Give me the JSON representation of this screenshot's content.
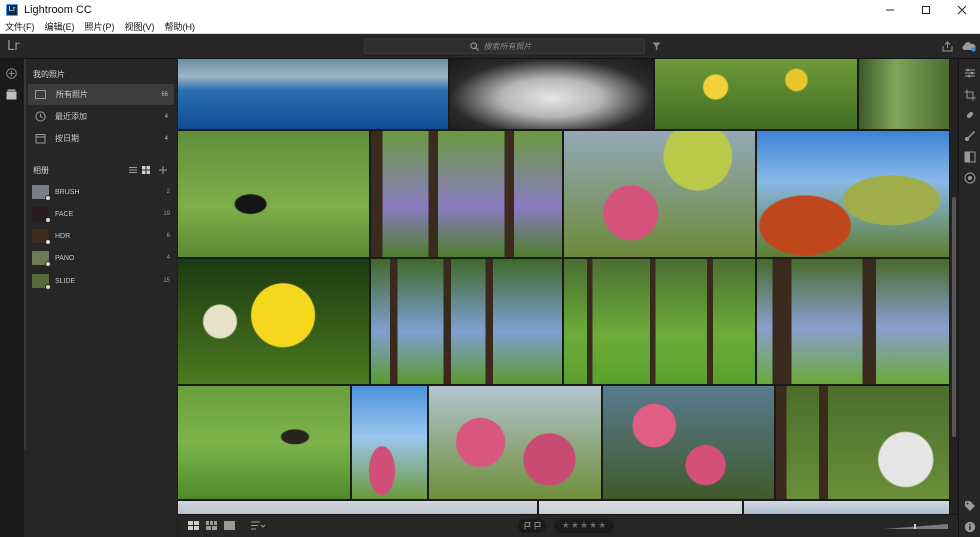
{
  "window": {
    "title": "Lightroom CC",
    "app_badge": "Lr"
  },
  "menu": [
    "文件(F)",
    "编辑(E)",
    "照片(P)",
    "视图(V)",
    "帮助(H)"
  ],
  "appbar": {
    "logo": "Lr",
    "search_placeholder": "搜索所有照片"
  },
  "left_panel": {
    "my_photos_title": "我的照片",
    "nav": [
      {
        "label": "所有照片",
        "count": "66",
        "icon": "photo-stack-icon",
        "active": true
      },
      {
        "label": "最近添加",
        "count": "4",
        "icon": "clock-icon",
        "active": false
      },
      {
        "label": "按日期",
        "count": "4",
        "icon": "calendar-icon",
        "active": false
      }
    ],
    "albums_title": "相册",
    "albums": [
      {
        "label": "BRUSH",
        "count": "2",
        "thumb": "#7a7f83"
      },
      {
        "label": "FACE",
        "count": "19",
        "thumb": "#2b1a1f"
      },
      {
        "label": "HDR",
        "count": "6",
        "thumb": "#3d2c1d"
      },
      {
        "label": "PANO",
        "count": "4",
        "thumb": "#6e7a55"
      },
      {
        "label": "SLIDE",
        "count": "15",
        "thumb": "#556b3a"
      }
    ]
  },
  "photos": [
    {
      "name": "pool",
      "bg": "linear-gradient(#6b8fa6 0%, #9fb6c4 25%, #2b6fb1 45%, #0f4c93 100%)"
    },
    {
      "name": "supercar",
      "bg": "radial-gradient(ellipse at 50% 55%, #e6e6e6 0%, #b5b5b5 35%, #2a2a2a 70%, #1a1a1a 100%)"
    },
    {
      "name": "yellow-flowers",
      "bg": "radial-gradient(circle at 30% 40%, #f2d13a 0 8%, transparent 9%), radial-gradient(circle at 70% 30%, #e9c52c 0 7%, transparent 8%), linear-gradient(#6e9a3a, #3f6e22)"
    },
    {
      "name": "forest-path-top",
      "bg": "linear-gradient(90deg, #3d5a2a, #7fa55a 40%, #4b6d31)"
    },
    {
      "name": "blackbird",
      "bg": "radial-gradient(ellipse at 38% 58%, #151515 0 9%, transparent 10%), linear-gradient(#5f8f3b, #7fae4a 60%, #5a8a32)"
    },
    {
      "name": "violet-forest",
      "bg": "linear-gradient(90deg, #3b2a1e 0 6%, transparent 6% 30%, #3b2a1e 30% 35%, transparent 35% 70%, #3b2a1e 70% 75%, transparent 75%), linear-gradient(#6a9a3e, #8a7ac0 60%, #4f7f2d)"
    },
    {
      "name": "pink-blossom-tree",
      "bg": "radial-gradient(circle at 35% 65%, #d5527c 0 18%, transparent 19%), radial-gradient(circle at 70% 20%, #b9c94a 0 20%, transparent 21%), linear-gradient(#94a8b8, #6c8a3a)"
    },
    {
      "name": "autumn-sky",
      "bg": "radial-gradient(ellipse at 25% 75%, #c0461c 0 22%, transparent 23%), radial-gradient(ellipse at 70% 55%, #9fae4a 0 25%, transparent 26%), linear-gradient(#3d82d6 0%, #8ab9e8 40%, #5e7d2f 100%)"
    },
    {
      "name": "rapeseed-butterfly",
      "bg": "radial-gradient(circle at 22% 50%, #e8e2c8 0 10%, transparent 11%), radial-gradient(circle at 55% 45%, #f5d81e 0 25%, transparent 26%), linear-gradient(#1d3a12, #4a7a1e)"
    },
    {
      "name": "forest-bluebells",
      "bg": "linear-gradient(90deg, transparent 0 10%, #3a2a1e 10% 14%, transparent 14% 38%, #3a2a1e 38% 42%, transparent 42% 60%, #3a2a1e 60% 64%, transparent 64%), linear-gradient(#3f6a2a, #7f9fd2 58%, #5a9a2f)"
    },
    {
      "name": "forest-lawn",
      "bg": "linear-gradient(90deg, transparent 0 12%, #3a2a1e 12% 15%, transparent 15% 45%, #3a2a1e 45% 48%, transparent 48% 75%, #3a2a1e 75% 78%, transparent 78%), linear-gradient(#4b6e32, #6dac3a 60%, #5aa02c)"
    },
    {
      "name": "forest-bench",
      "bg": "linear-gradient(90deg, transparent 0 8%, #3a2a1e 8% 18%, transparent 18% 55%, #3a2a1e 55% 62%, transparent 62%), linear-gradient(#476a2c, #8a9fcf 55%, #6aa83a)"
    },
    {
      "name": "bird-on-branch",
      "bg": "radial-gradient(ellipse at 68% 45%, #2a241c 0 8%, transparent 9%), linear-gradient(#6a9f3a, #7db44a 50%, #4f8a2a)"
    },
    {
      "name": "sky-blossom",
      "bg": "radial-gradient(ellipse at 40% 75%, #d0507a 0 20%, transparent 21%), linear-gradient(#4b93dc 0%, #9cc7ef 45%, #6a9a3a 100%)"
    },
    {
      "name": "pink-orchard",
      "bg": "radial-gradient(circle at 30% 50%, #d8567f 0 18%, transparent 19%), radial-gradient(circle at 70% 65%, #c94a73 0 18%, transparent 19%), linear-gradient(#b3c4cf, #6f8f3a)"
    },
    {
      "name": "blossom-closeup",
      "bg": "radial-gradient(circle at 30% 35%, #e05d86 0 15%, transparent 16%), radial-gradient(circle at 60% 70%, #d45079 0 15%, transparent 16%), linear-gradient(#5a7a8f, #3f5a2a)"
    },
    {
      "name": "white-blossom-forest",
      "bg": "radial-gradient(circle at 75% 65%, #e5e5e5 0 18%, transparent 19%), linear-gradient(90deg, #3c2a1e 0 6%, transparent 6% 25%, #3c2a1e 25% 30%, transparent 30%), linear-gradient(#4a6e2a, #6a8f3a)"
    },
    {
      "name": "partial-bottom-1",
      "bg": "linear-gradient(#cfd7df, #b9c4cf)"
    },
    {
      "name": "partial-bottom-2",
      "bg": "linear-gradient(#d8dde2, #c7ced6)"
    },
    {
      "name": "partial-bottom-3",
      "bg": "linear-gradient(#cfd9e2, #aebccb)"
    }
  ],
  "bottom": {
    "stars": [
      "★",
      "★",
      "★",
      "★",
      "★"
    ]
  }
}
